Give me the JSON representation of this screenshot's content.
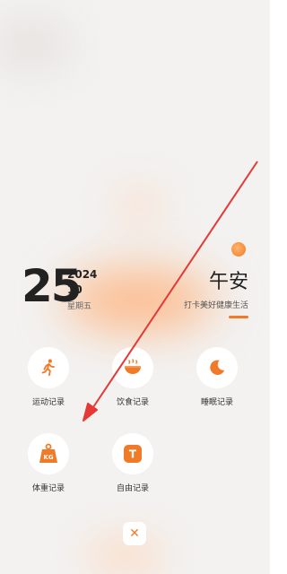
{
  "date": {
    "day": "25",
    "year": "2024",
    "month": "10",
    "weekday": "星期五"
  },
  "greeting": {
    "title": "午安",
    "subtitle": "打卡美好健康生活"
  },
  "actions": [
    {
      "label": "运动记录",
      "icon": "running-person-icon"
    },
    {
      "label": "饮食记录",
      "icon": "food-bowl-icon"
    },
    {
      "label": "睡眠记录",
      "icon": "moon-icon"
    },
    {
      "label": "体重记录",
      "icon": "weight-kg-icon"
    },
    {
      "label": "自由记录",
      "icon": "t-letter-icon"
    }
  ],
  "weight_icon_text": "KG",
  "custom_icon_text": "T",
  "close_glyph": "✕",
  "colors": {
    "accent": "#f07a28",
    "arrow": "#e53935",
    "background": "#f3f2f1"
  }
}
